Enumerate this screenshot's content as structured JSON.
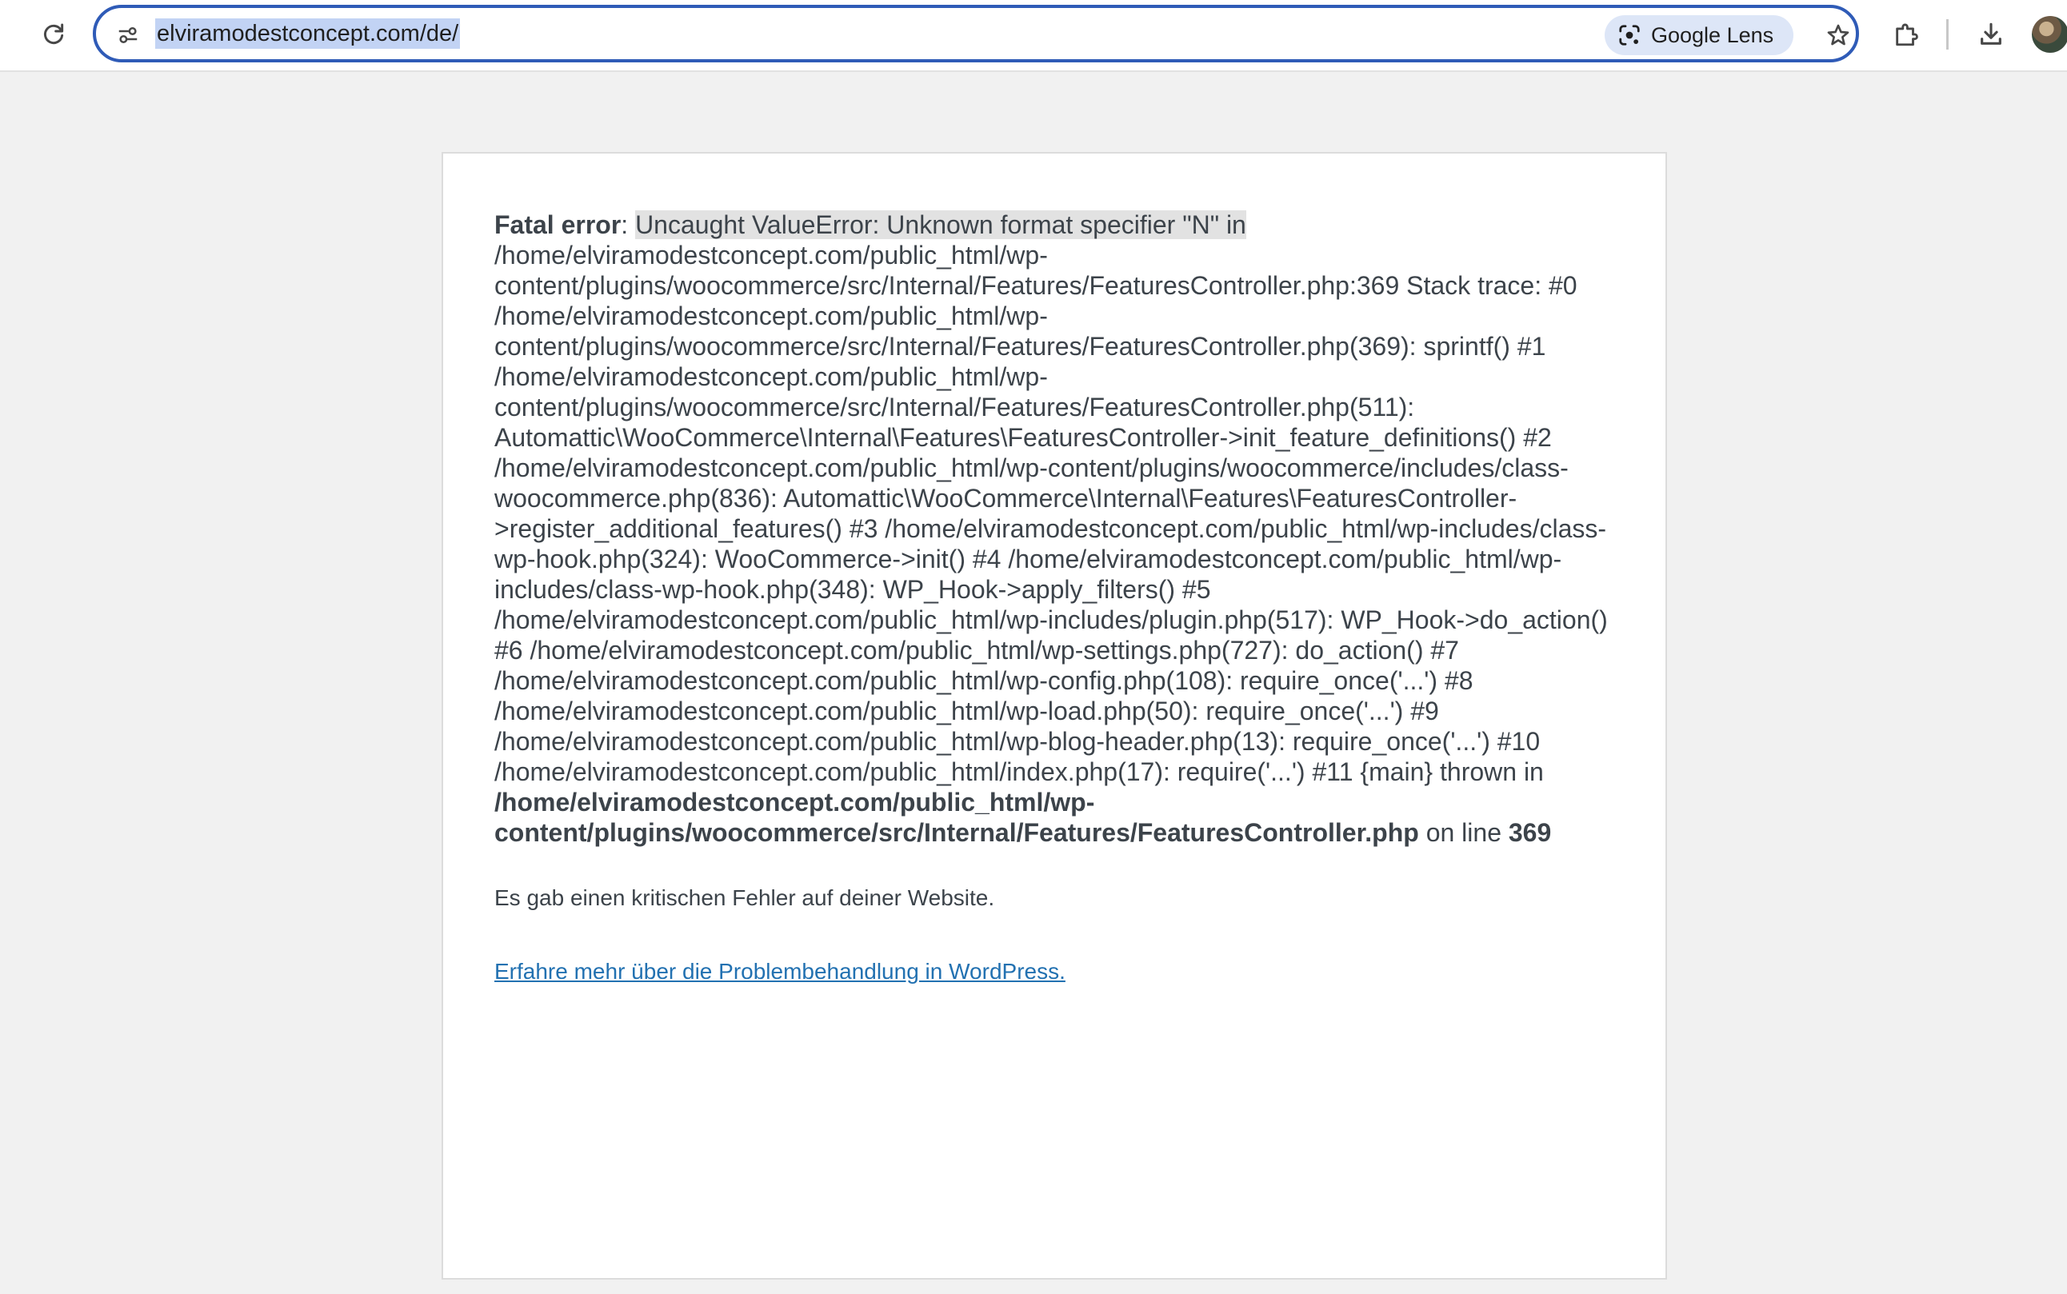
{
  "browser": {
    "url": "elviramodestconcept.com/de/",
    "lens_label": "Google Lens"
  },
  "error": {
    "label": "Fatal error",
    "separator": ": ",
    "message": "Uncaught ValueError: Unknown format specifier \"N\" in",
    "trace": " /home/elviramodestconcept.com/public_html/wp-content/plugins/woocommerce/src/Internal/Features/FeaturesController.php:369 Stack trace: #0 /home/elviramodestconcept.com/public_html/wp-content/plugins/woocommerce/src/Internal/Features/FeaturesController.php(369): sprintf() #1 /home/elviramodestconcept.com/public_html/wp-content/plugins/woocommerce/src/Internal/Features/FeaturesController.php(511): Automattic\\WooCommerce\\Internal\\Features\\FeaturesController->init_feature_definitions() #2 /home/elviramodestconcept.com/public_html/wp-content/plugins/woocommerce/includes/class-woocommerce.php(836): Automattic\\WooCommerce\\Internal\\Features\\FeaturesController->register_additional_features() #3 /home/elviramodestconcept.com/public_html/wp-includes/class-wp-hook.php(324): WooCommerce->init() #4 /home/elviramodestconcept.com/public_html/wp-includes/class-wp-hook.php(348): WP_Hook->apply_filters() #5 /home/elviramodestconcept.com/public_html/wp-includes/plugin.php(517): WP_Hook->do_action() #6 /home/elviramodestconcept.com/public_html/wp-settings.php(727): do_action() #7 /home/elviramodestconcept.com/public_html/wp-config.php(108): require_once('...') #8 /home/elviramodestconcept.com/public_html/wp-load.php(50): require_once('...') #9 /home/elviramodestconcept.com/public_html/wp-blog-header.php(13): require_once('...') #10 /home/elviramodestconcept.com/public_html/index.php(17): require('...') #11 {main} thrown in ",
    "file": "/home/elviramodestconcept.com/public_html/wp-content/plugins/woocommerce/src/Internal/Features/FeaturesController.php",
    "on_line_text": " on line ",
    "line": "369"
  },
  "notice": "Es gab einen kritischen Fehler auf deiner Website.",
  "help_link": "Erfahre mehr über die Problembehandlung in WordPress.",
  "colors": {
    "link": "#2271b1",
    "text": "#3c434a",
    "omnibox_border": "#2f5bb7"
  },
  "icons": [
    "reload-icon",
    "site-settings-icon",
    "google-lens-icon",
    "star-icon",
    "extensions-icon",
    "download-icon"
  ]
}
